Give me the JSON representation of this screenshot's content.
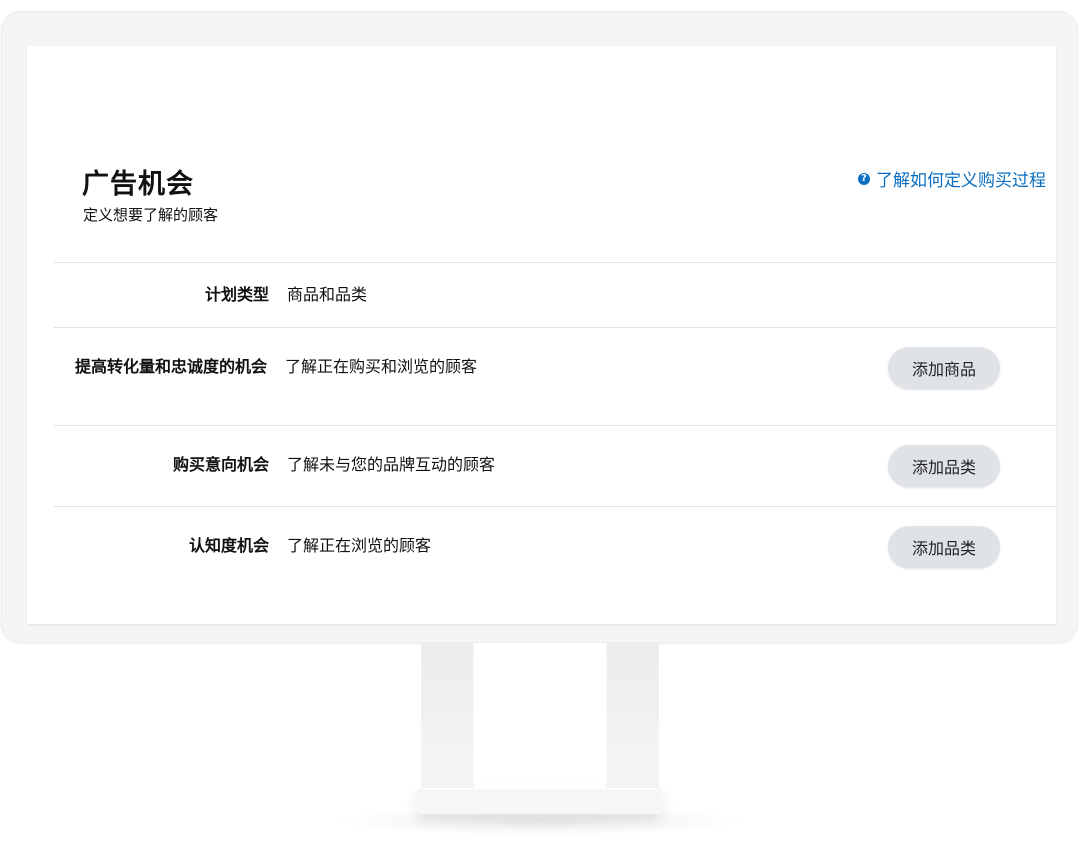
{
  "header": {
    "title": "广告机会",
    "subtitle": "定义想要了解的顾客",
    "help_icon": "question-circle-icon",
    "help_link": "了解如何定义购买过程"
  },
  "rows": [
    {
      "label": "计划类型",
      "value": "商品和品类",
      "button": ""
    },
    {
      "label": "提高转化量和忠诚度的机会",
      "value": "了解正在购买和浏览的顾客",
      "button": "添加商品"
    },
    {
      "label": "购买意向机会",
      "value": "了解未与您的品牌互动的顾客",
      "button": "添加品类"
    },
    {
      "label": "认知度机会",
      "value": "了解正在浏览的顾客",
      "button": "添加品类"
    }
  ],
  "colors": {
    "link": "#0a6fc2",
    "button_bg": "#dfe2e7",
    "divider": "#e3e3e3"
  }
}
